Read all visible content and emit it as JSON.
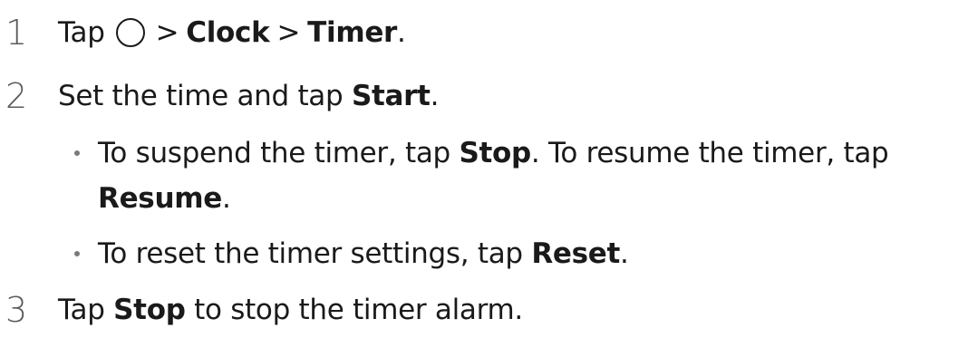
{
  "steps": [
    {
      "number": "1",
      "parts": {
        "t1": "Tap",
        "gt1": ">",
        "b1": "Clock",
        "gt2": ">",
        "b2": "Timer",
        "end": "."
      },
      "icon": "home-circle-icon"
    },
    {
      "number": "2",
      "parts": {
        "t1": "Set the time and tap",
        "b1": "Start",
        "end": "."
      },
      "bullets": [
        {
          "t1": "To suspend the timer, tap",
          "b1": "Stop",
          "t2": ". To resume the timer, tap",
          "b2": "Resume",
          "end": "."
        },
        {
          "t1": "To reset the timer settings, tap",
          "b1": "Reset",
          "end": "."
        }
      ]
    },
    {
      "number": "3",
      "parts": {
        "t1": "Tap",
        "b1": "Stop",
        "t2": "to stop the timer alarm."
      }
    }
  ]
}
